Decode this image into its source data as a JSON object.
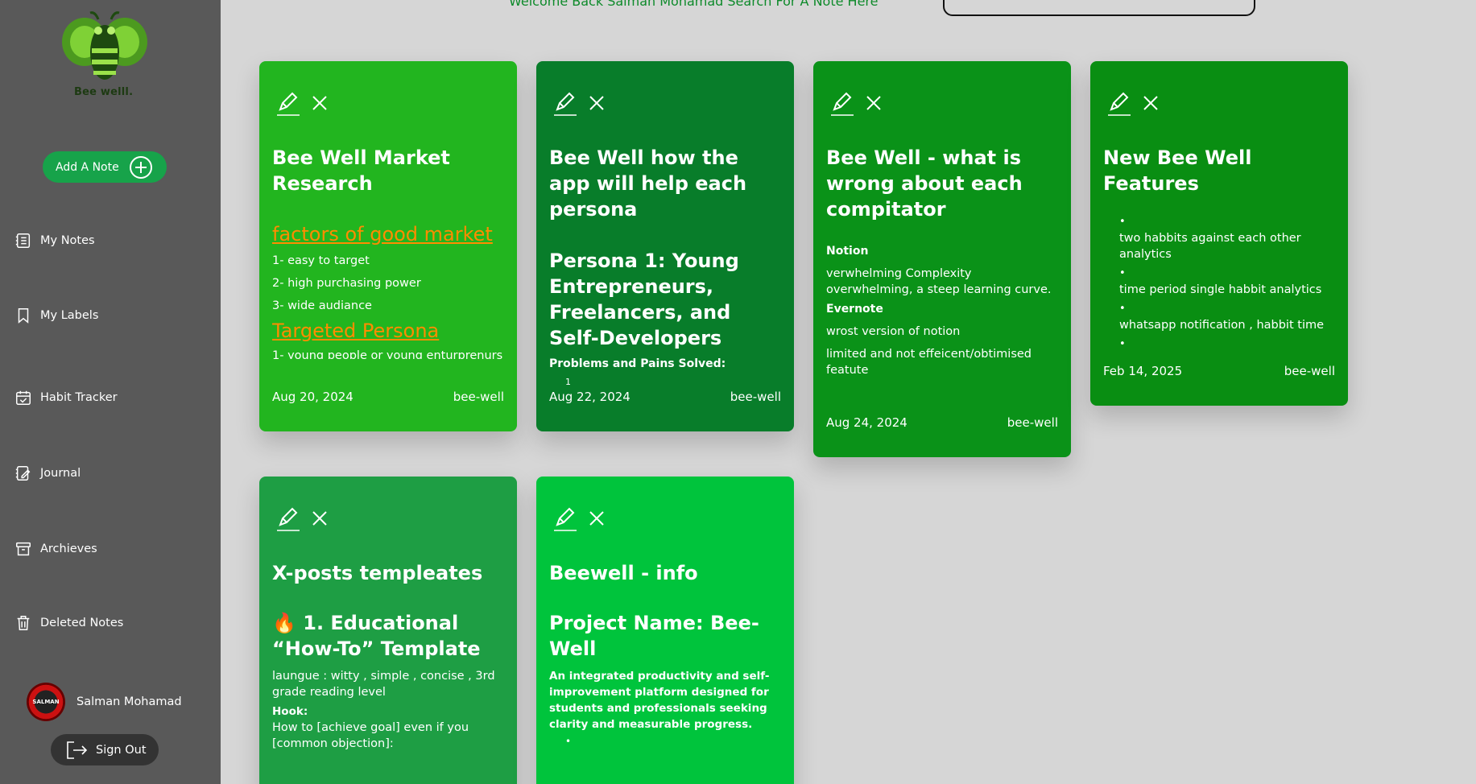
{
  "sidebar": {
    "logo_text": "Bee welll.",
    "add_note_label": "Add A Note",
    "nav": [
      {
        "label": "My Notes",
        "icon": "notes-icon"
      },
      {
        "label": "My Labels",
        "icon": "bookmark-icon"
      },
      {
        "label": "Habit Tracker",
        "icon": "calendar-check-icon"
      },
      {
        "label": "Journal",
        "icon": "journal-edit-icon"
      },
      {
        "label": "Archieves",
        "icon": "archive-icon"
      },
      {
        "label": "Deleted Notes",
        "icon": "trash-icon"
      }
    ],
    "user_name": "Salman Mohamad",
    "avatar_text": "SALMAN",
    "sign_out_label": "Sign Out"
  },
  "header": {
    "welcome": "Welcome Back Salman Mohamad Search For A Note Here",
    "search_placeholder": ""
  },
  "cards": [
    {
      "title": "Bee Well Market Research",
      "section1": "factors of good market",
      "items": [
        "1- easy to target",
        "2- high purchasing power",
        "3- wide audiance"
      ],
      "section2": "Targeted Persona",
      "cut_line": "1- young people or young enturprenurs",
      "date": "Aug 20, 2024",
      "label": "bee-well",
      "color": "#22b51f"
    },
    {
      "title": "Bee Well how the app will help each persona",
      "heading": "Persona 1: Young Entrepreneurs, Freelancers, and Self-Developers",
      "subheading": "Problems and Pains Solved:",
      "list_start": "1",
      "date": "Aug 22, 2024",
      "label": "bee-well",
      "color": "#087d2a"
    },
    {
      "title": "Bee Well - what is wrong about each compitator",
      "comp1": "Notion",
      "comp1_text": "verwhelming Complexity overwhelming, a steep learning curve.",
      "comp2": "Evernote",
      "comp2_text1": "wrost version of notion",
      "comp2_text2": "limited and not effeicent/obtimised featute",
      "date": "Aug 24, 2024",
      "label": "bee-well",
      "color": "#0a9218"
    },
    {
      "title": "New Bee Well Features",
      "bullets": [
        "two habbits against each other analytics",
        "time period single habbit analytics",
        "whatsapp notification , habbit time"
      ],
      "date": "Feb 14, 2025",
      "label": "bee-well",
      "color": "#098e12"
    },
    {
      "title": "X-posts templeates",
      "heading": "🔥 1. Educational “How-To” Template",
      "text": "laungue : witty , simple , concise , 3rd grade reading level",
      "hook_label": "Hook:",
      "hook_text": "How to [achieve goal] even if you [common objection]:",
      "color": "#1e9e44"
    },
    {
      "title": "Beewell - info",
      "heading": "Project Name: Bee-Well",
      "text": "An integrated productivity and self-improvement platform designed for students and professionals seeking clarity and measurable progress.",
      "color": "#00c43c"
    }
  ]
}
